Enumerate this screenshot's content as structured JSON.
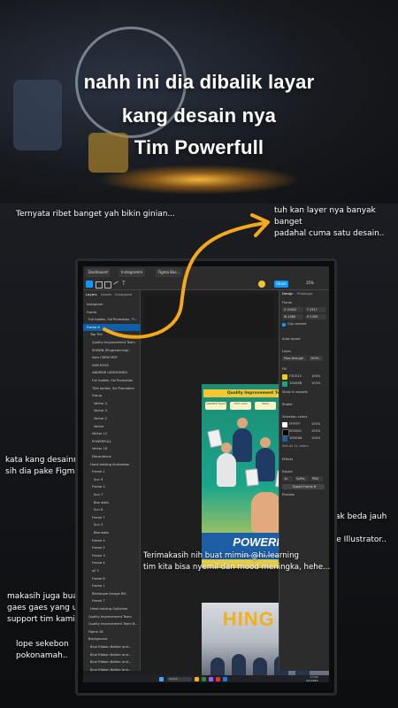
{
  "headline": [
    "nahh ini dia dibalik layar",
    "kang desain nya",
    "Tim Powerfull"
  ],
  "captions": {
    "top_left": "Ternyata ribet banget yah bikin ginian...",
    "top_right": [
      "tuh kan layer nya banyak banget",
      "padahal cuma satu desain.."
    ],
    "mid_left": [
      "kata kang desainnya",
      "sih dia pake Figma.."
    ],
    "mid_right": [
      "katanya Gak beda jauh ko'",
      "kaya Adobe Illustrator.."
    ],
    "thanks": [
      "Terimakasih nih buat mimin @hi.learning",
      "tim kita bisa nyemil dan mood meningka, hehe..."
    ],
    "bottom_left": [
      "makasih juga buat",
      "gaes gaes yang udah",
      "support tim kami.."
    ],
    "bottom_left2": [
      "lope sekebon",
      "pokonamah.."
    ]
  },
  "figma": {
    "tabs": [
      "Dashboard",
      "Instagramm",
      "Figma Bas..."
    ],
    "share_label": "Share",
    "zoom": "35%",
    "left_tabs": [
      "Layers",
      "Assets",
      "Instagram"
    ],
    "layers": [
      "Instagram",
      "Frame",
      "Full bodies, Sol Promotion, Ti...",
      "Frame 6",
      "Top Tier",
      "Quality Improvement Team",
      "SHAWN (Programming)",
      "Sam CREW MSP",
      "SAM ROSS",
      "ANDREW UIDESIGNED",
      "Full bodies, Sol Promotion",
      "Title bodies, Sol Promotion",
      "Group",
      "Vector 4",
      "Vector 3",
      "Vector 2",
      "Vector",
      "Vector 12",
      "POWERFULL",
      "Vector 18",
      "Decorations",
      "Hand-holding illustration",
      "Frame 1",
      "Sun 9",
      "Frame 2",
      "Sun 7",
      "Boo walls",
      "Sun 6",
      "Frame 7",
      "Sun 3",
      "Boo walls",
      "Frame 4",
      "Frame 5",
      "Frame 3",
      "Frame 4",
      "all 3",
      "Frame 6",
      "Frame 1",
      "Rectangle (Image 89)",
      "Frame 7",
      "Hand-holding Guillotine",
      "Quality Improvement Team",
      "Quality Improvement Team B...",
      "Figma 18",
      "Background",
      "Blue Ribbon Battler and...",
      "Blue Ribbon Battler and...",
      "Blue Ribbon Battler and...",
      "Blue Ribbon Battler and..."
    ],
    "right_tabs": [
      "Design",
      "Prototype"
    ],
    "props": {
      "frame_label": "Frame",
      "x": "X 19422",
      "y": "Y 2417",
      "w": "W 1080",
      "h": "H 1350",
      "clip": "Clip content",
      "auto_layout": "Auto layout",
      "layer_label": "Layer",
      "pass": "Pass through",
      "pass_val": "100%",
      "fill_label": "Fill",
      "fill_hex": "F3CE13",
      "fill_pct": "100%",
      "fill2_hex": "19A58B",
      "fill2_pct": "100%",
      "show_exports": "Show in exports",
      "stroke_label": "Stroke",
      "selection_colors": "Selection colors",
      "sel_colors": [
        {
          "hex": "FFFFFF",
          "pct": "100%"
        },
        {
          "hex": "000000",
          "pct": "100%"
        },
        {
          "hex": "1D5EA6",
          "pct": "100%"
        }
      ],
      "see_all": "See all 11 colors",
      "effects": "Effects",
      "export": "Export",
      "export_scale": "1x",
      "export_suffix": "Suffix",
      "export_format": "PNG",
      "export_button": "Export Frame 6",
      "preview": "Preview"
    },
    "poster": {
      "banner": "Quality Improvement Team Batch 5",
      "chips": [
        "ANDREW FAJAR",
        "MUH. ALWI",
        "REZA",
        "ASEP S.",
        "SHAWN"
      ],
      "logo": "POWERFUL",
      "sub": "Quality Improvement Team Batch 5"
    },
    "photo_title": "HING PE",
    "taskbar": {
      "search": "Search",
      "time": "17:03",
      "date": "2/1/2024"
    }
  },
  "colors": {
    "accent": "#0d99ff",
    "poster_green": "#19a58b",
    "poster_yellow": "#f3ce13",
    "poster_blue": "#1d5ea6",
    "arrow": "#f3a91b"
  }
}
